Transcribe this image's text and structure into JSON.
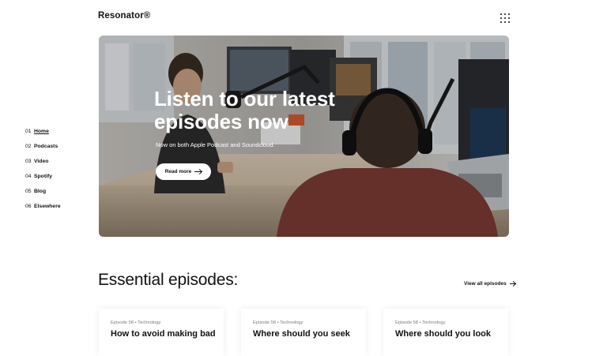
{
  "brand": {
    "name": "Resonator®"
  },
  "icons": {
    "menu": "grid-menu-icon",
    "arrow": "arrow-right-icon"
  },
  "nav": {
    "items": [
      {
        "num": "01",
        "label": "Home",
        "active": true
      },
      {
        "num": "02",
        "label": "Podcasts",
        "active": false
      },
      {
        "num": "03",
        "label": "Video",
        "active": false
      },
      {
        "num": "04",
        "label": "Spotify",
        "active": false
      },
      {
        "num": "05",
        "label": "Blog",
        "active": false
      },
      {
        "num": "06",
        "label": "Elsewhere",
        "active": false
      }
    ]
  },
  "hero": {
    "title": "Listen to our latest episodes now",
    "subtitle": "Now on both Apple Podcast and Soundcloud.",
    "button_label": "Read more"
  },
  "episodes": {
    "heading": "Essential episodes:",
    "view_all_label": "View all episodes",
    "cards": [
      {
        "meta": "Episode 58 • Technology",
        "title": "How to avoid making bad"
      },
      {
        "meta": "Episode 58 • Technology",
        "title": "Where should you seek"
      },
      {
        "meta": "Episode 58 • Technology",
        "title": "Where should you look"
      }
    ]
  },
  "colors": {
    "accent": "#111111",
    "background": "#ffffff",
    "meta_text": "#7a7a7a"
  }
}
